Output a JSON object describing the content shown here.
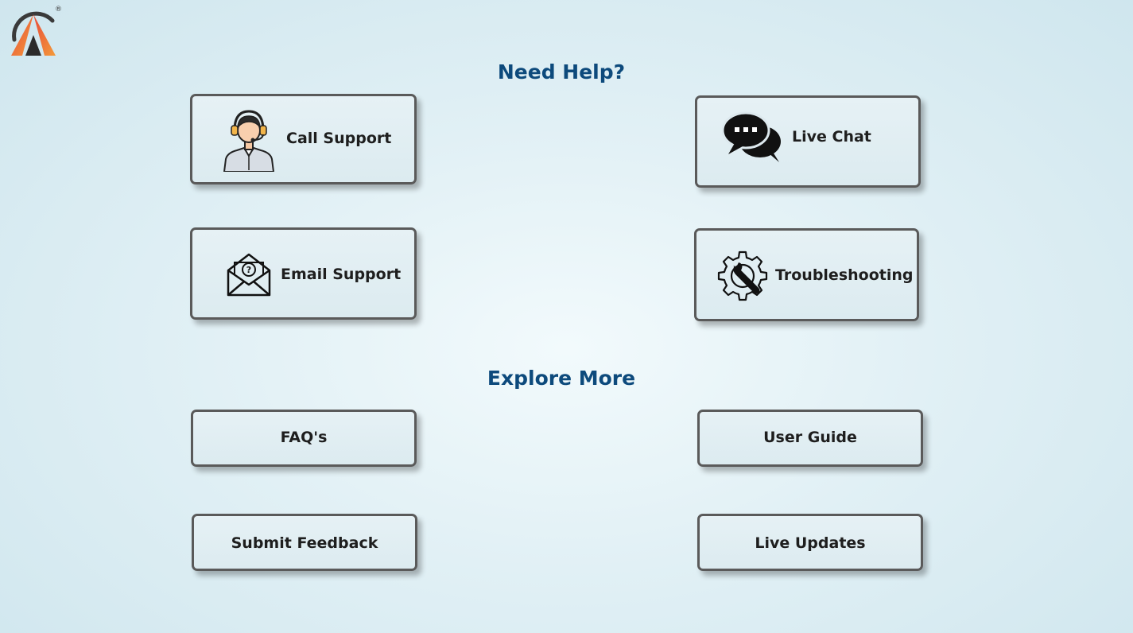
{
  "logo": {
    "icon": "brand-a-logo",
    "registered_mark": "®",
    "colors": {
      "ring": "#3a3a3a",
      "gradient_start": "#e84b3a",
      "gradient_end": "#f39a3a"
    }
  },
  "need_help": {
    "title": "Need Help?",
    "cards": {
      "call_support": {
        "label": "Call Support",
        "icon": "headset-agent-icon"
      },
      "live_chat": {
        "label": "Live Chat",
        "icon": "chat-bubbles-icon"
      },
      "email_support": {
        "label": "Email Support",
        "icon": "email-question-icon"
      },
      "troubleshooting": {
        "label": "Troubleshooting",
        "icon": "gear-wrench-icon"
      }
    }
  },
  "explore_more": {
    "title": "Explore More",
    "cards": {
      "faqs": {
        "label": "FAQ's"
      },
      "user_guide": {
        "label": "User Guide"
      },
      "submit_feedback": {
        "label": "Submit Feedback"
      },
      "live_updates": {
        "label": "Live Updates"
      }
    }
  },
  "theme": {
    "title_color": "#0d4a7c",
    "card_border": "#5a5a5a",
    "label_color": "#1e1e1e"
  }
}
